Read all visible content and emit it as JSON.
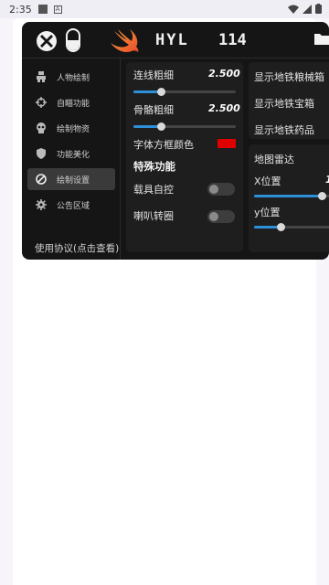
{
  "status": {
    "time": "2:35"
  },
  "header": {
    "title": "HYL",
    "version": "114"
  },
  "sidebar": {
    "items": [
      {
        "label": "人物绘制",
        "icon": "character-icon"
      },
      {
        "label": "自瞄功能",
        "icon": "crosshair-icon"
      },
      {
        "label": "绘制物资",
        "icon": "skull-icon"
      },
      {
        "label": "功能美化",
        "icon": "shield-icon"
      },
      {
        "label": "绘制设置",
        "icon": "forbidden-icon",
        "active": true
      },
      {
        "label": "公告区域",
        "icon": "gear-icon"
      }
    ],
    "agreement": "使用协议(点击查看)"
  },
  "draw_settings": {
    "line_width": {
      "label": "连线粗细",
      "value": "2.500",
      "fraction": 0.17
    },
    "bone_width": {
      "label": "骨骼粗细",
      "value": "2.500",
      "fraction": 0.17
    },
    "font_box_color": {
      "label": "字体方框颜色",
      "color": "#e00000"
    },
    "special_title": "特殊功能",
    "vehicle_control": {
      "label": "载具自控",
      "on": false
    },
    "horn_spin": {
      "label": "喇叭转圈",
      "on": false
    }
  },
  "right_top": {
    "items": [
      "显示地铁粮械箱",
      "显示地铁宝箱",
      "显示地铁药品"
    ]
  },
  "map_radar": {
    "title": "地图雷达",
    "x_pos": {
      "label": "X位置",
      "value": "1",
      "fraction": 0.9
    },
    "y_pos": {
      "label": "y位置",
      "fraction": 0.3
    }
  },
  "colors": {
    "accent": "#2d8fd8",
    "panel_bg": "#151515",
    "card_bg": "#1e1e1e"
  }
}
